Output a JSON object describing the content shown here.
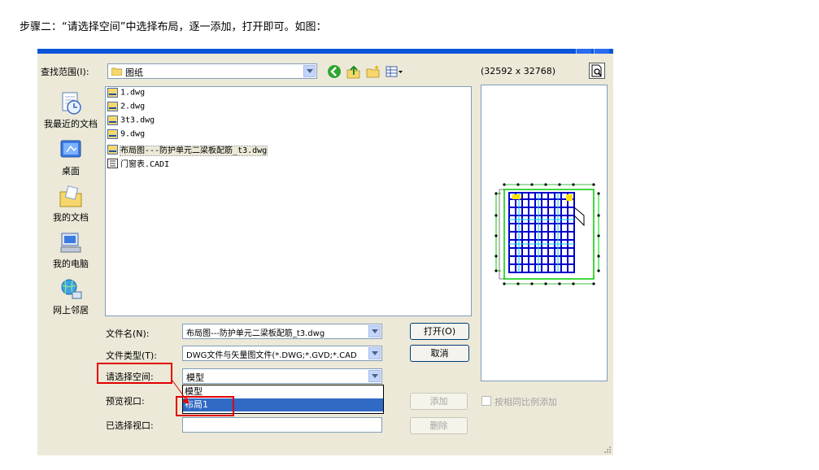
{
  "instruction": "步骤二：“请选择空间”中选择布局，逐一添加，打开即可。如图：",
  "dialog": {
    "look_in_label": "查找范围(I):",
    "look_in_value": "图纸",
    "preview_size": "(32592 x 32768)",
    "places": [
      {
        "label": "我最近的文档",
        "icon": "recent-documents-icon"
      },
      {
        "label": "桌面",
        "icon": "desktop-icon"
      },
      {
        "label": "我的文档",
        "icon": "my-documents-icon"
      },
      {
        "label": "我的电脑",
        "icon": "my-computer-icon"
      },
      {
        "label": "网上邻居",
        "icon": "network-places-icon"
      }
    ],
    "files": [
      {
        "name": "1.dwg",
        "icon": "dwg-file-icon"
      },
      {
        "name": "2.dwg",
        "icon": "dwg-file-icon"
      },
      {
        "name": "3t3.dwg",
        "icon": "dwg-file-icon"
      },
      {
        "name": "9.dwg",
        "icon": "dwg-file-icon"
      },
      {
        "name": "布局图---防护单元二梁板配筋_t3.dwg",
        "icon": "dwg-file-icon",
        "selected": true
      },
      {
        "name": "门窗表.CADI",
        "icon": "cadi-file-icon"
      }
    ],
    "filename_label": "文件名(N):",
    "filename_value": "布局图---防护单元二梁板配筋_t3.dwg",
    "filetype_label": "文件类型(T):",
    "filetype_value": "DWG文件与矢量图文件(*.DWG;*.GVD;*.CAD",
    "space_label": "请选择空间:",
    "space_value": "模型",
    "space_options": [
      "模型",
      "布局1"
    ],
    "space_highlighted": "布局1",
    "preview_viewport_label": "预览视口:",
    "selected_viewport_label": "已选择视口:",
    "open_button": "打开(O)",
    "cancel_button": "取消",
    "add_button": "添加",
    "delete_button": "删除",
    "same_scale_label": "按相同比例添加",
    "same_scale_checked": false
  },
  "colors": {
    "dialog_bg": "#ece9d8",
    "highlight": "#316ac5",
    "annotation_red": "#e00000",
    "plan_blue": "#0000cc",
    "plan_green": "#00cc00"
  }
}
